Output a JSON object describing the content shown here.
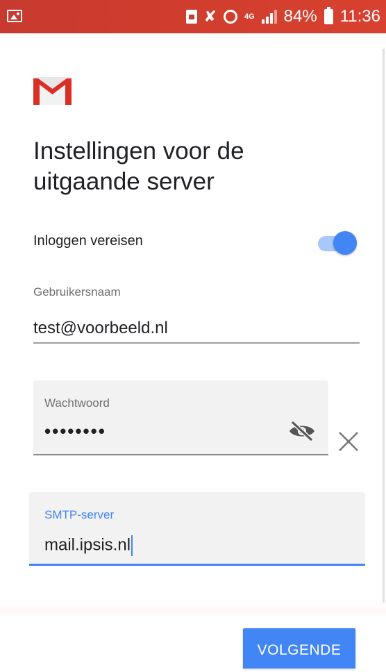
{
  "status_bar": {
    "network": "4G",
    "battery_percent": "84%",
    "time": "11:36"
  },
  "page": {
    "title_line1": "Instellingen voor de",
    "title_line2": "uitgaande server"
  },
  "login_toggle": {
    "label": "Inloggen vereisen",
    "enabled": true
  },
  "username": {
    "label": "Gebruikersnaam",
    "value": "test@voorbeeld.nl"
  },
  "password": {
    "label": "Wachtwoord",
    "value": "••••••••"
  },
  "smtp_server": {
    "label": "SMTP-server",
    "value": "mail.ipsis.nl"
  },
  "next_button": {
    "label": "VOLGENDE"
  },
  "colors": {
    "status_bar": "#c8392f",
    "accent": "#4285f4",
    "field_background": "#f2f2f2"
  },
  "icons": {
    "gmail_logo": "gmail-logo",
    "visibility_off": "eye-off-icon",
    "clear": "close-icon"
  }
}
